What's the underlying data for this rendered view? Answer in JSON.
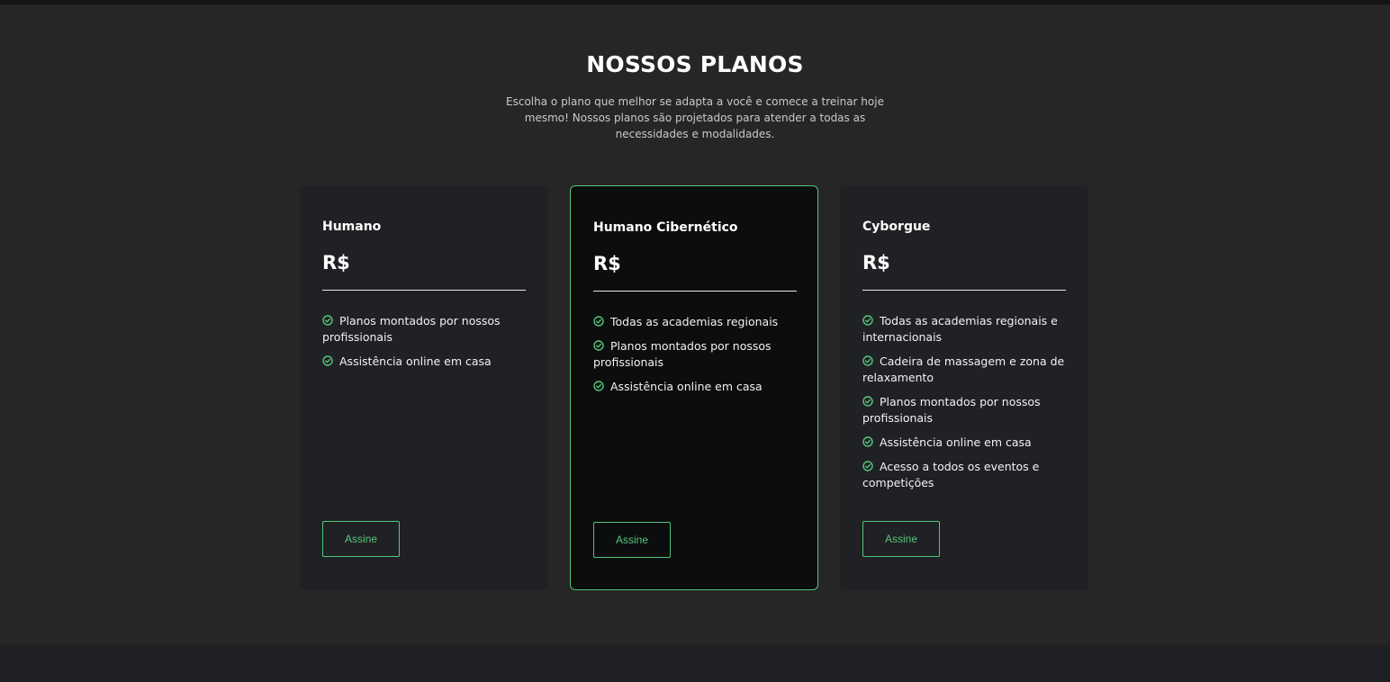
{
  "section": {
    "title": "NOSSOS PLANOS",
    "subtitle": "Escolha o plano que melhor se adapta a você e comece a treinar hoje mesmo! Nossos planos são projetados para atender a todas as necessidades e modalidades."
  },
  "plans": [
    {
      "name": "Humano",
      "price": "R$",
      "features": [
        "Planos montados por nossos profissionais",
        "Assistência online em casa"
      ],
      "button_label": "Assine"
    },
    {
      "name": "Humano Cibernético",
      "price": "R$",
      "features": [
        "Todas as academias regionais",
        "Planos montados por nossos profissionais",
        "Assistência online em casa"
      ],
      "button_label": "Assine"
    },
    {
      "name": "Cyborgue",
      "price": "R$",
      "features": [
        "Todas as academias regionais e internacionais",
        "Cadeira de massagem e zona de relaxamento",
        "Planos montados por nossos profissionais",
        "Assistência online em casa",
        "Acesso a todos os eventos e competições"
      ],
      "button_label": "Assine"
    }
  ],
  "icons": {
    "feature": "check-circle-icon"
  },
  "colors": {
    "accent": "#53c77a",
    "background": "#272526",
    "card": "#202124",
    "card_featured": "#0c0d0f"
  }
}
